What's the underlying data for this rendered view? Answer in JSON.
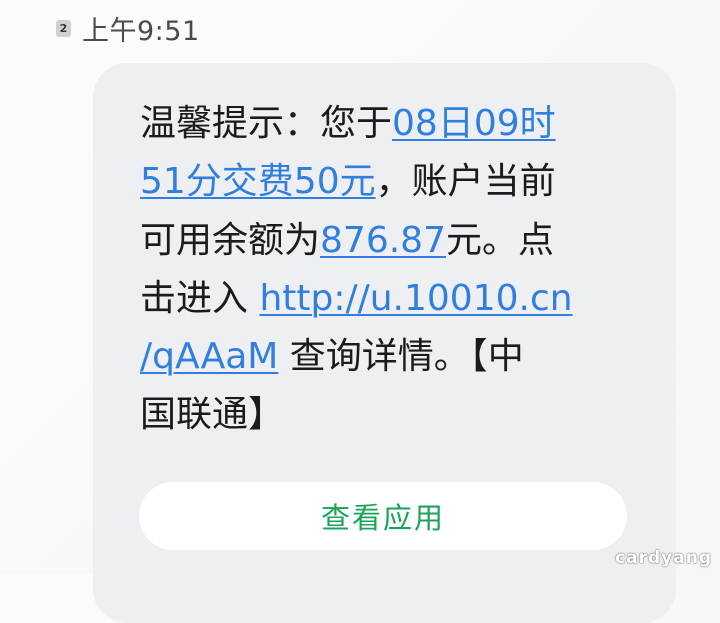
{
  "header": {
    "sim_slot": "2",
    "time": "上午9:51"
  },
  "message": {
    "line1_text": "温馨提示：您于",
    "line1_link": "08日09时",
    "line2_link": "51分交费50元",
    "line2_text": "，账户当前",
    "line3_text_a": "可用余额为",
    "line3_link": "876.87",
    "line3_text_b": "元。点",
    "line4_text": "击进入 ",
    "line4_link": "http://u.10010.cn",
    "line5_link": "/qAAaM",
    "line5_text": " 查询详情。【中",
    "line6_text": "国联通】"
  },
  "actions": {
    "view_app_label": "查看应用"
  },
  "watermark": "cardyang",
  "colors": {
    "link": "#2f7fde",
    "button_text": "#1aa35a",
    "bubble_bg": "#eeeff3"
  }
}
